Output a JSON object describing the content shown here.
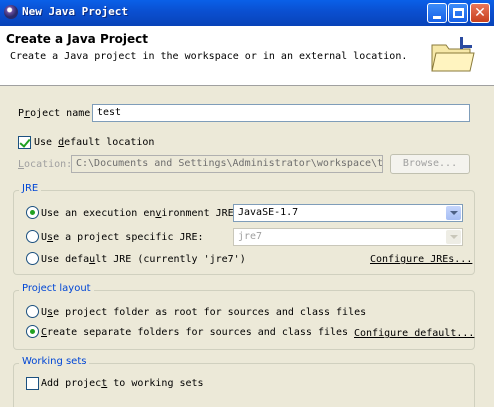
{
  "window": {
    "title": "New Java Project"
  },
  "banner": {
    "title": "Create a Java Project",
    "description": "Create a Java project in the workspace or in an external location."
  },
  "project_name": {
    "label_pre": "P",
    "label_u": "r",
    "label_post": "oject name:",
    "value": "test"
  },
  "default_location": {
    "checked": true,
    "label_pre": "Use ",
    "label_u": "d",
    "label_post": "efault location"
  },
  "location": {
    "label_pre": "",
    "label_u": "L",
    "label_post": "ocation:",
    "value": "C:\\Documents and Settings\\Administrator\\workspace\\test",
    "browse_label": "Browse..."
  },
  "jre": {
    "group_label": "JRE",
    "option_env": {
      "label_pre": "Use an execution en",
      "label_u": "v",
      "label_post": "ironment JRE:",
      "value": "JavaSE-1.7",
      "selected": true
    },
    "option_specific": {
      "label_pre": "U",
      "label_u": "s",
      "label_post": "e a project specific JRE:",
      "value": "jre7"
    },
    "option_default": {
      "label_pre": "Use defa",
      "label_u": "u",
      "label_post": "lt JRE (currently 'jre7')"
    },
    "configure_link": "Configure JREs..."
  },
  "layout": {
    "group_label": "Project layout",
    "option_root": {
      "label_pre": "U",
      "label_u": "s",
      "label_post": "e project folder as root for sources and class files"
    },
    "option_separate": {
      "label_pre": "",
      "label_u": "C",
      "label_post": "reate separate folders for sources and class files",
      "selected": true
    },
    "configure_link": "Configure default..."
  },
  "working_sets": {
    "group_label": "Working sets",
    "add_checkbox": {
      "label_pre": "Add projec",
      "label_u": "t",
      "label_post": " to working sets"
    }
  },
  "colors": {
    "titlebar": "#0a4fd0",
    "dialog_bg": "#ece9d8",
    "group_label": "#0046d5",
    "check": "#21a121"
  }
}
